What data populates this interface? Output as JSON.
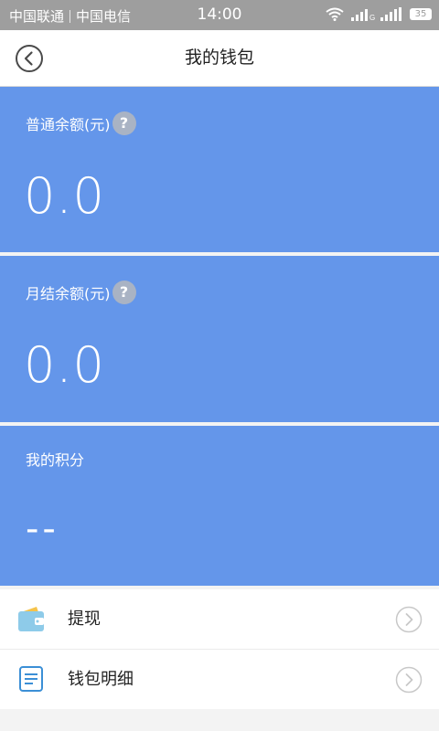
{
  "status_bar": {
    "carrier_1": "中国联通",
    "carrier_2": "中国电信",
    "time": "14:00",
    "battery": "35"
  },
  "header": {
    "title": "我的钱包"
  },
  "cards": [
    {
      "label": "普通余额(元)",
      "value": "0.0",
      "has_help": true
    },
    {
      "label": "月结余额(元)",
      "value": "0.0",
      "has_help": true
    },
    {
      "label": "我的积分",
      "value": "--",
      "has_help": false
    }
  ],
  "help_icon_glyph": "?",
  "menu": [
    {
      "label": "提现",
      "icon": "wallet-icon"
    },
    {
      "label": "钱包明细",
      "icon": "document-list-icon"
    }
  ],
  "colors": {
    "card_background": "#6496ea",
    "help_badge": "#a9b3c4",
    "status_bar": "#9e9e9e"
  }
}
